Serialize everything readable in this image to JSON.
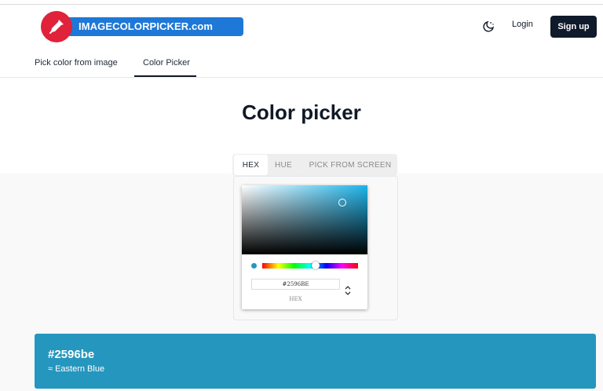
{
  "header": {
    "logo_text": "IMAGECOLORPICKER.com",
    "login": "Login",
    "signup": "Sign up"
  },
  "nav": {
    "tabs": [
      {
        "label": "Pick color from image",
        "active": false
      },
      {
        "label": "Color Picker",
        "active": true
      }
    ]
  },
  "page": {
    "title": "Color picker"
  },
  "picker": {
    "tabs": [
      "HEX",
      "HUE",
      "PICK FROM SCREEN"
    ],
    "active_tab": "HEX",
    "hex_value": "#2596BE",
    "input_label": "HEX"
  },
  "result": {
    "hex": "#2596be",
    "name": "≈ Eastern Blue",
    "color": "#2596be"
  },
  "colors": {
    "brand_blue": "#1e78d7",
    "logo_red": "#e0223a",
    "signup_bg": "#0f1a2b",
    "selected_color": "#2596be"
  }
}
